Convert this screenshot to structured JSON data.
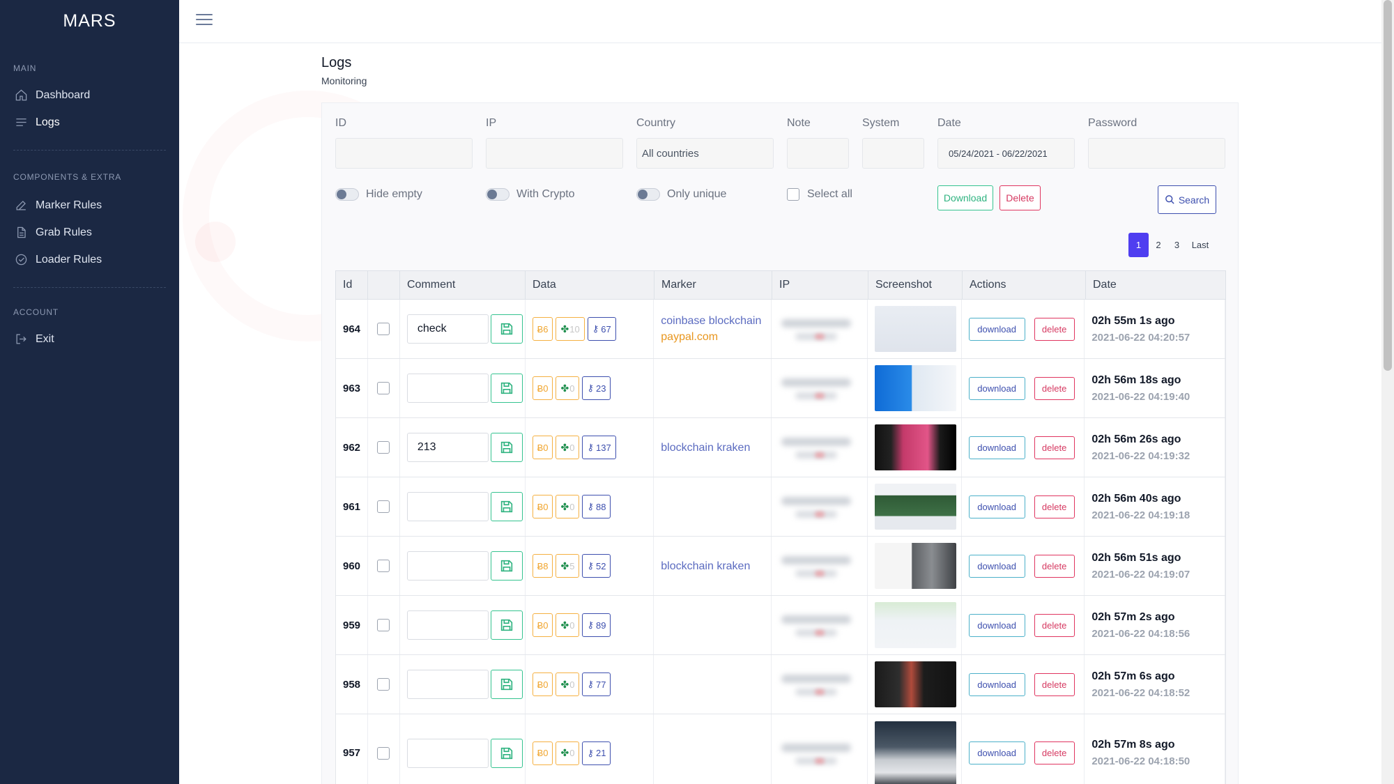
{
  "brand": "MARS",
  "sidebar": {
    "sections": [
      {
        "title": "MAIN",
        "items": [
          {
            "label": "Dashboard",
            "icon": "home-icon"
          },
          {
            "label": "Logs",
            "icon": "list-icon"
          }
        ]
      },
      {
        "title": "COMPONENTS & EXTRA",
        "items": [
          {
            "label": "Marker Rules",
            "icon": "edit-icon"
          },
          {
            "label": "Grab Rules",
            "icon": "file-icon"
          },
          {
            "label": "Loader Rules",
            "icon": "check-circle-icon"
          }
        ]
      },
      {
        "title": "ACCOUNT",
        "items": [
          {
            "label": "Exit",
            "icon": "logout-icon"
          }
        ]
      }
    ]
  },
  "page": {
    "title": "Logs",
    "subtitle": "Monitoring"
  },
  "filters": {
    "id_label": "ID",
    "ip_label": "IP",
    "country_label": "Country",
    "country_value": "All countries",
    "note_label": "Note",
    "system_label": "System",
    "date_label": "Date",
    "date_value": "05/24/2021 - 06/22/2021",
    "password_label": "Password",
    "hide_empty": "Hide empty",
    "with_crypto": "With Crypto",
    "only_unique": "Only unique",
    "select_all": "Select all",
    "download": "Download",
    "delete": "Delete",
    "search": "Search"
  },
  "pagination": {
    "pages": [
      "1",
      "2",
      "3"
    ],
    "last": "Last",
    "current": "1"
  },
  "table": {
    "headers": {
      "id": "Id",
      "comment": "Comment",
      "data": "Data",
      "marker": "Marker",
      "ip": "IP",
      "screenshot": "Screenshot",
      "actions": "Actions",
      "date": "Date"
    },
    "download_label": "download",
    "delete_label": "delete",
    "rows": [
      {
        "id": "964",
        "comment": "check",
        "btc": "6",
        "clover": "10",
        "key": "67",
        "markers": [
          {
            "text": "coinbase blockchain",
            "color": "blue"
          },
          {
            "text": "paypal.com",
            "color": "orange"
          }
        ],
        "rel": "02h 55m 1s ago",
        "abs": "2021-06-22 04:20:57"
      },
      {
        "id": "963",
        "comment": "",
        "btc": "0",
        "clover": "0",
        "key": "23",
        "markers": [],
        "rel": "02h 56m 18s ago",
        "abs": "2021-06-22 04:19:40"
      },
      {
        "id": "962",
        "comment": "213",
        "btc": "0",
        "clover": "0",
        "key": "137",
        "markers": [
          {
            "text": "blockchain kraken",
            "color": "blue"
          }
        ],
        "rel": "02h 56m 26s ago",
        "abs": "2021-06-22 04:19:32"
      },
      {
        "id": "961",
        "comment": "",
        "btc": "0",
        "clover": "0",
        "key": "88",
        "markers": [],
        "rel": "02h 56m 40s ago",
        "abs": "2021-06-22 04:19:18"
      },
      {
        "id": "960",
        "comment": "",
        "btc": "8",
        "clover": "5",
        "key": "52",
        "markers": [
          {
            "text": "blockchain kraken",
            "color": "blue"
          }
        ],
        "rel": "02h 56m 51s ago",
        "abs": "2021-06-22 04:19:07"
      },
      {
        "id": "959",
        "comment": "",
        "btc": "0",
        "clover": "0",
        "key": "89",
        "markers": [],
        "rel": "02h 57m 2s ago",
        "abs": "2021-06-22 04:18:56"
      },
      {
        "id": "958",
        "comment": "",
        "btc": "0",
        "clover": "0",
        "key": "77",
        "markers": [],
        "rel": "02h 57m 6s ago",
        "abs": "2021-06-22 04:18:52"
      },
      {
        "id": "957",
        "comment": "",
        "btc": "0",
        "clover": "0",
        "key": "21",
        "markers": [],
        "rel": "02h 57m 8s ago",
        "abs": "2021-06-22 04:18:50"
      }
    ]
  },
  "colors": {
    "sidebar_bg": "#1b2843",
    "accent": "#4f3ef0",
    "green": "#34c38f",
    "red": "#e0345f",
    "btc": "#f5b041",
    "key": "#3d4fae"
  }
}
